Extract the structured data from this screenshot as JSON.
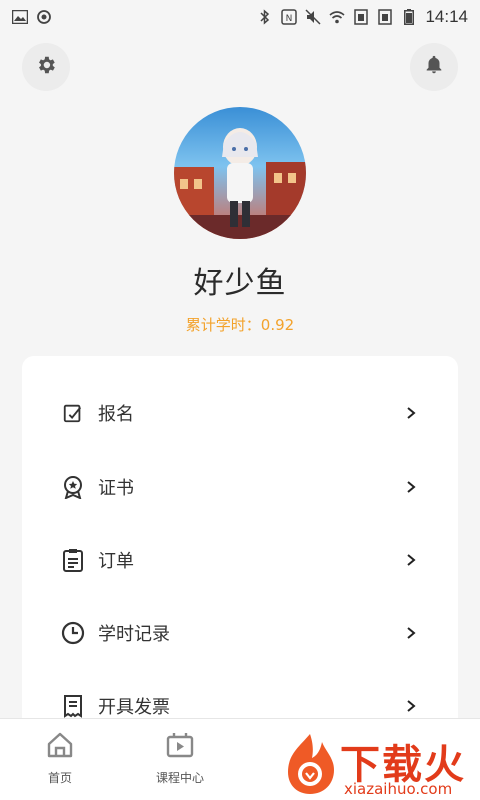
{
  "status_bar": {
    "time": "14:14",
    "left_icons": [
      "image-icon",
      "sync-icon"
    ],
    "right_icons": [
      "bluetooth-icon",
      "nfc-icon",
      "mute-icon",
      "wifi-icon",
      "sim1-icon",
      "sim2-icon",
      "battery-icon"
    ]
  },
  "header": {
    "settings_icon": "gear-icon",
    "notification_icon": "bell-icon"
  },
  "profile": {
    "name": "好少鱼",
    "study_hours": "累计学时：0.92"
  },
  "menu": {
    "items": [
      {
        "label": "报名",
        "icon": "edit-icon"
      },
      {
        "label": "证书",
        "icon": "badge-icon"
      },
      {
        "label": "订单",
        "icon": "clipboard-icon"
      },
      {
        "label": "学时记录",
        "icon": "clock-icon"
      },
      {
        "label": "开具发票",
        "icon": "receipt-icon"
      }
    ]
  },
  "tabbar": {
    "tabs": [
      {
        "label": "首页",
        "icon": "home-icon"
      },
      {
        "label": "课程中心",
        "icon": "course-icon"
      }
    ]
  },
  "watermark": {
    "title": "下载火",
    "url": "xiazaihuo.com"
  },
  "colors": {
    "accent": "#f3a22b",
    "watermark": "#e23b1a",
    "background": "#f5f5f5"
  }
}
